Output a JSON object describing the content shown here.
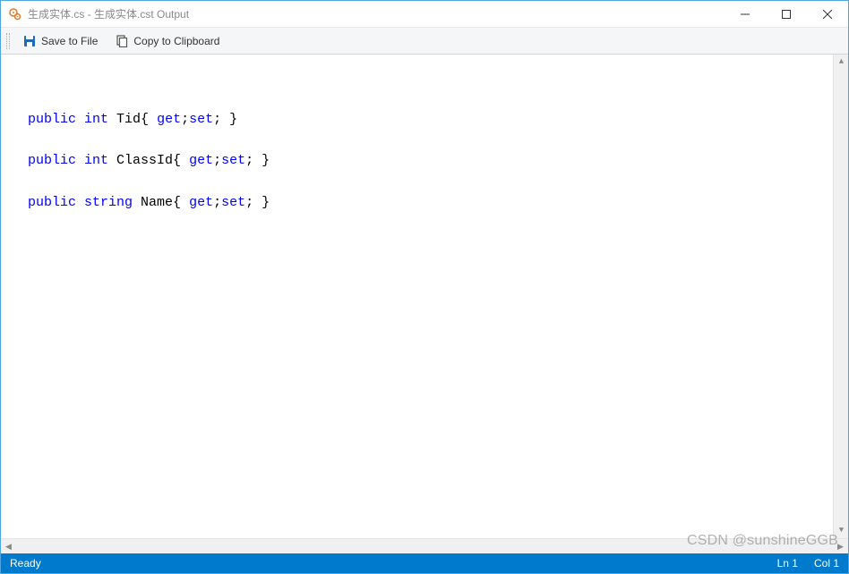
{
  "window": {
    "title": "生成实体.cs - 生成实体.cst Output"
  },
  "toolbar": {
    "save_label": "Save to File",
    "copy_label": "Copy to Clipboard"
  },
  "code": {
    "lines": [
      {
        "tokens": [
          {
            "t": "public",
            "c": "kw"
          },
          {
            "t": " "
          },
          {
            "t": "int",
            "c": "kw"
          },
          {
            "t": " Tid{ "
          },
          {
            "t": "get",
            "c": "kw"
          },
          {
            "t": ";"
          },
          {
            "t": "set",
            "c": "kw"
          },
          {
            "t": "; }"
          }
        ]
      },
      {
        "blank": true
      },
      {
        "tokens": [
          {
            "t": "public",
            "c": "kw"
          },
          {
            "t": " "
          },
          {
            "t": "int",
            "c": "kw"
          },
          {
            "t": " ClassId{ "
          },
          {
            "t": "get",
            "c": "kw"
          },
          {
            "t": ";"
          },
          {
            "t": "set",
            "c": "kw"
          },
          {
            "t": "; }"
          }
        ]
      },
      {
        "blank": true
      },
      {
        "tokens": [
          {
            "t": "public",
            "c": "kw"
          },
          {
            "t": " "
          },
          {
            "t": "string",
            "c": "kw"
          },
          {
            "t": " Name{ "
          },
          {
            "t": "get",
            "c": "kw"
          },
          {
            "t": ";"
          },
          {
            "t": "set",
            "c": "kw"
          },
          {
            "t": "; }"
          }
        ]
      }
    ]
  },
  "statusbar": {
    "ready": "Ready",
    "line": "Ln 1",
    "col": "Col 1"
  },
  "watermark": "CSDN @sunshineGGB"
}
